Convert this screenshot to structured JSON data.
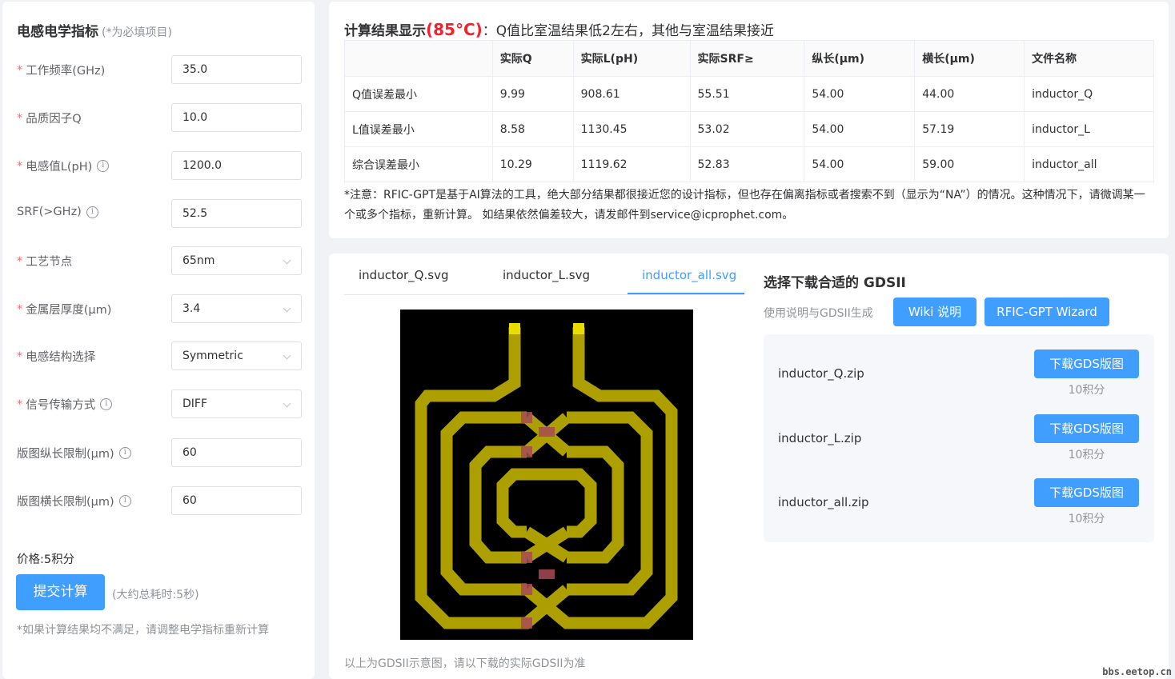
{
  "form": {
    "title": "电感电学指标",
    "required_note": "(*为必填项目)",
    "fields": [
      {
        "label": "工作频率(GHz)",
        "value": "35.0",
        "required": true,
        "info": false,
        "type": "input"
      },
      {
        "label": "品质因子Q",
        "value": "10.0",
        "required": true,
        "info": false,
        "type": "input"
      },
      {
        "label": "电感值L(pH)",
        "value": "1200.0",
        "required": true,
        "info": true,
        "type": "input"
      },
      {
        "label": "SRF(>GHz)",
        "value": "52.5",
        "required": false,
        "info": true,
        "type": "input"
      },
      {
        "label": "工艺节点",
        "value": "65nm",
        "required": true,
        "info": false,
        "type": "select"
      },
      {
        "label": "金属层厚度(μm)",
        "value": "3.4",
        "required": true,
        "info": false,
        "type": "select"
      },
      {
        "label": "电感结构选择",
        "value": "Symmetric",
        "required": true,
        "info": false,
        "type": "select"
      },
      {
        "label": "信号传输方式",
        "value": "DIFF",
        "required": true,
        "info": true,
        "type": "select"
      },
      {
        "label": "版图纵长限制(μm)",
        "value": "60",
        "required": false,
        "info": true,
        "type": "input"
      },
      {
        "label": "版图横长限制(μm)",
        "value": "60",
        "required": false,
        "info": true,
        "type": "input"
      }
    ],
    "price": "价格:5积分",
    "submit_label": "提交计算",
    "time_note": "(大约总耗时:5秒)",
    "footnote": "*如果计算结果均不满足，请调整电学指标重新计算"
  },
  "result": {
    "heading_main": "计算结果显示",
    "heading_temp": "(85°C)",
    "heading_sub": "：Q值比室温结果低2左右，其他与室温结果接近",
    "columns": [
      "",
      "实际Q",
      "实际L(pH)",
      "实际SRF≥",
      "纵长(μm)",
      "横长(μm)",
      "文件名称"
    ],
    "rows": [
      [
        "Q值误差最小",
        "9.99",
        "908.61",
        "55.51",
        "54.00",
        "44.00",
        "inductor_Q"
      ],
      [
        "L值误差最小",
        "8.58",
        "1130.45",
        "53.02",
        "54.00",
        "57.19",
        "inductor_L"
      ],
      [
        "综合误差最小",
        "10.29",
        "1119.62",
        "52.83",
        "54.00",
        "59.00",
        "inductor_all"
      ]
    ],
    "note": "*注意：RFIC-GPT是基于AI算法的工具，绝大部分结果都很接近您的设计指标，但也存在偏离指标或者搜索不到（显示为“NA”）的情况。这种情况下，请微调某一个或多个指标，重新计算。 如结果依然偏差较大，请发邮件到service@icprophet.com。"
  },
  "preview": {
    "tabs": [
      "inductor_Q.svg",
      "inductor_L.svg",
      "inductor_all.svg"
    ],
    "active_tab": 2,
    "note": "以上为GDSII示意图，请以下载的实际GDSII为准"
  },
  "download": {
    "title": "选择下载合适的 GDSII",
    "subtitle": "使用说明与GDSII生成",
    "wiki_label": "Wiki 说明",
    "wizard_label": "RFIC-GPT Wizard",
    "button_label": "下载GDS版图",
    "files": [
      {
        "name": "inductor_Q.zip",
        "cost": "10积分"
      },
      {
        "name": "inductor_L.zip",
        "cost": "10积分"
      },
      {
        "name": "inductor_all.zip",
        "cost": "10积分"
      }
    ]
  },
  "watermark": "bbs.eetop.cn",
  "colors": {
    "primary": "#409eff",
    "required": "#f56c6c",
    "temp": "#f5222d",
    "trace": "#b8a800",
    "via": "#a84a55"
  }
}
